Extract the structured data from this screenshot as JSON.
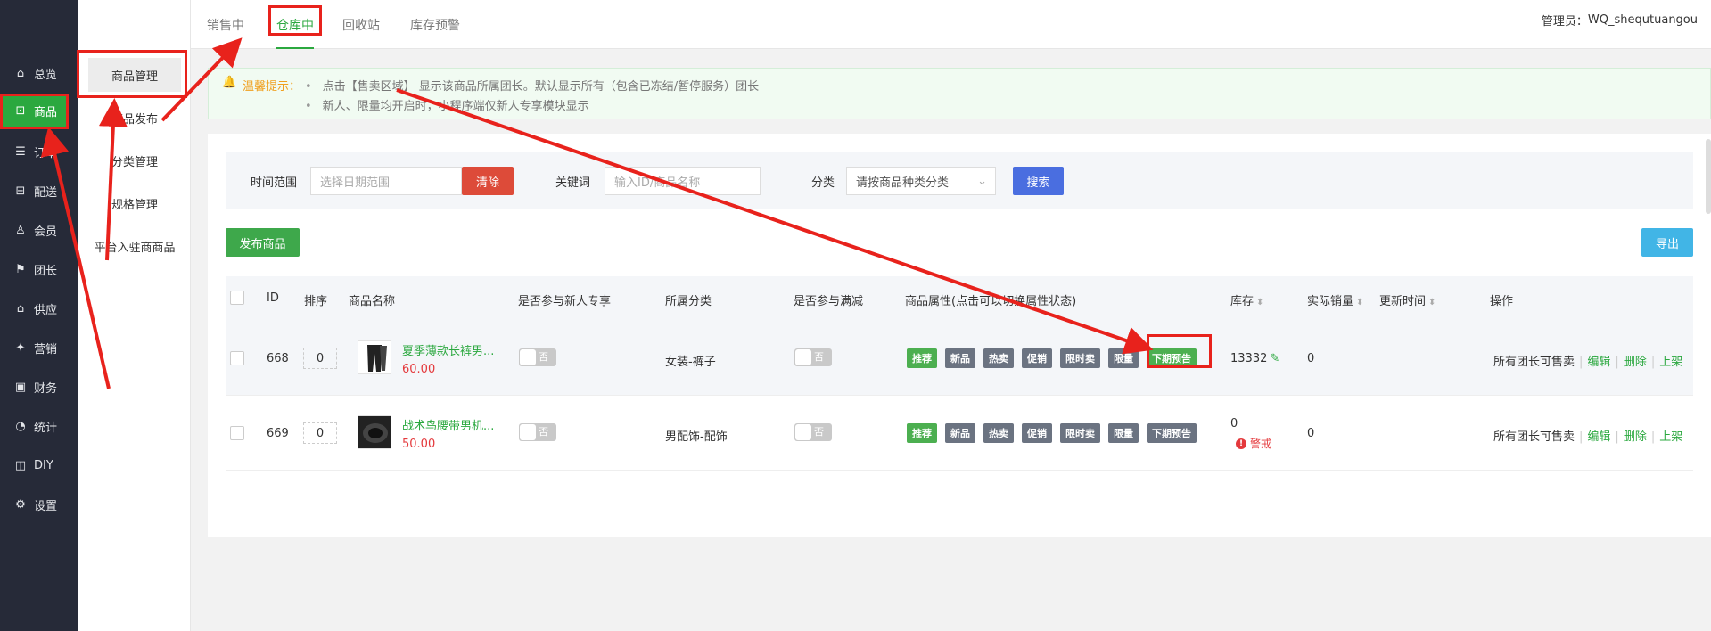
{
  "sidebar": {
    "items": [
      {
        "label": "总览",
        "icon": "home-icon",
        "glyph": "⌂"
      },
      {
        "label": "商品",
        "icon": "bag-icon",
        "glyph": "⊡"
      },
      {
        "label": "订单",
        "icon": "order-icon",
        "glyph": "☰"
      },
      {
        "label": "配送",
        "icon": "truck-icon",
        "glyph": "⊟"
      },
      {
        "label": "会员",
        "icon": "user-icon",
        "glyph": "♙"
      },
      {
        "label": "团长",
        "icon": "leader-icon",
        "glyph": "⚑"
      },
      {
        "label": "供应",
        "icon": "shop-icon",
        "glyph": "⌂"
      },
      {
        "label": "营销",
        "icon": "gift-icon",
        "glyph": "✦"
      },
      {
        "label": "财务",
        "icon": "finance-icon",
        "glyph": "▣"
      },
      {
        "label": "统计",
        "icon": "chart-icon",
        "glyph": "◔"
      },
      {
        "label": "DIY",
        "icon": "diy-icon",
        "glyph": "◫"
      },
      {
        "label": "设置",
        "icon": "gear-icon",
        "glyph": "⚙"
      }
    ]
  },
  "subnav": {
    "items": [
      "商品管理",
      "商品发布",
      "分类管理",
      "规格管理",
      "平台入驻商商品"
    ]
  },
  "tabs": [
    "销售中",
    "仓库中",
    "回收站",
    "库存预警"
  ],
  "admin": {
    "label": "管理员：",
    "name": "WQ_shequtuangou"
  },
  "tips": {
    "title": "温馨提示：",
    "lines": [
      "点击【售卖区域】 显示该商品所属团长。默认显示所有（包含已冻结/暂停服务）团长",
      "新人、限量均开启时，小程序端仅新人专享模块显示"
    ]
  },
  "filter": {
    "time_label": "时间范围",
    "time_placeholder": "选择日期范围",
    "clear_label": "清除",
    "keyword_label": "关键词",
    "keyword_placeholder": "输入ID/商品名称",
    "category_label": "分类",
    "category_value": "请按商品种类分类",
    "search_label": "搜索"
  },
  "actions": {
    "publish_label": "发布商品",
    "export_label": "导出"
  },
  "table": {
    "headers": [
      "ID",
      "排序",
      "商品名称",
      "是否参与新人专享",
      "所属分类",
      "是否参与满减",
      "商品属性(点击可以切换属性状态)",
      "库存",
      "实际销量",
      "更新时间",
      "操作"
    ],
    "rows": [
      {
        "id": "668",
        "sort": "0",
        "name": "夏季薄款长裤男...",
        "price": "60.00",
        "newcomer": "否",
        "category": "女装-裤子",
        "full_reduction": "否",
        "stock": "13332",
        "stock_warning": "",
        "sales": "0",
        "updated": "",
        "ops": [
          "所有团长可售卖",
          "编辑",
          "删除",
          "上架"
        ]
      },
      {
        "id": "669",
        "sort": "0",
        "name": "战术鸟腰带男机...",
        "price": "50.00",
        "newcomer": "否",
        "category": "男配饰-配饰",
        "full_reduction": "否",
        "stock": "0",
        "stock_warning": "警戒",
        "sales": "0",
        "updated": "",
        "ops": [
          "所有团长可售卖",
          "编辑",
          "删除",
          "上架"
        ]
      }
    ],
    "attributes": [
      "推荐",
      "新品",
      "热卖",
      "促销",
      "限时卖",
      "限量",
      "下期预告"
    ]
  },
  "colors": {
    "sidebar_bg": "#262a38",
    "accent_green": "#2ba83f",
    "annotation_red": "#e8221c",
    "clear_red": "#dd4b39",
    "search_blue": "#4a6ee0",
    "export_blue": "#41b5e6",
    "attr_gray": "#6b7381",
    "attr_green": "#4caf50"
  }
}
